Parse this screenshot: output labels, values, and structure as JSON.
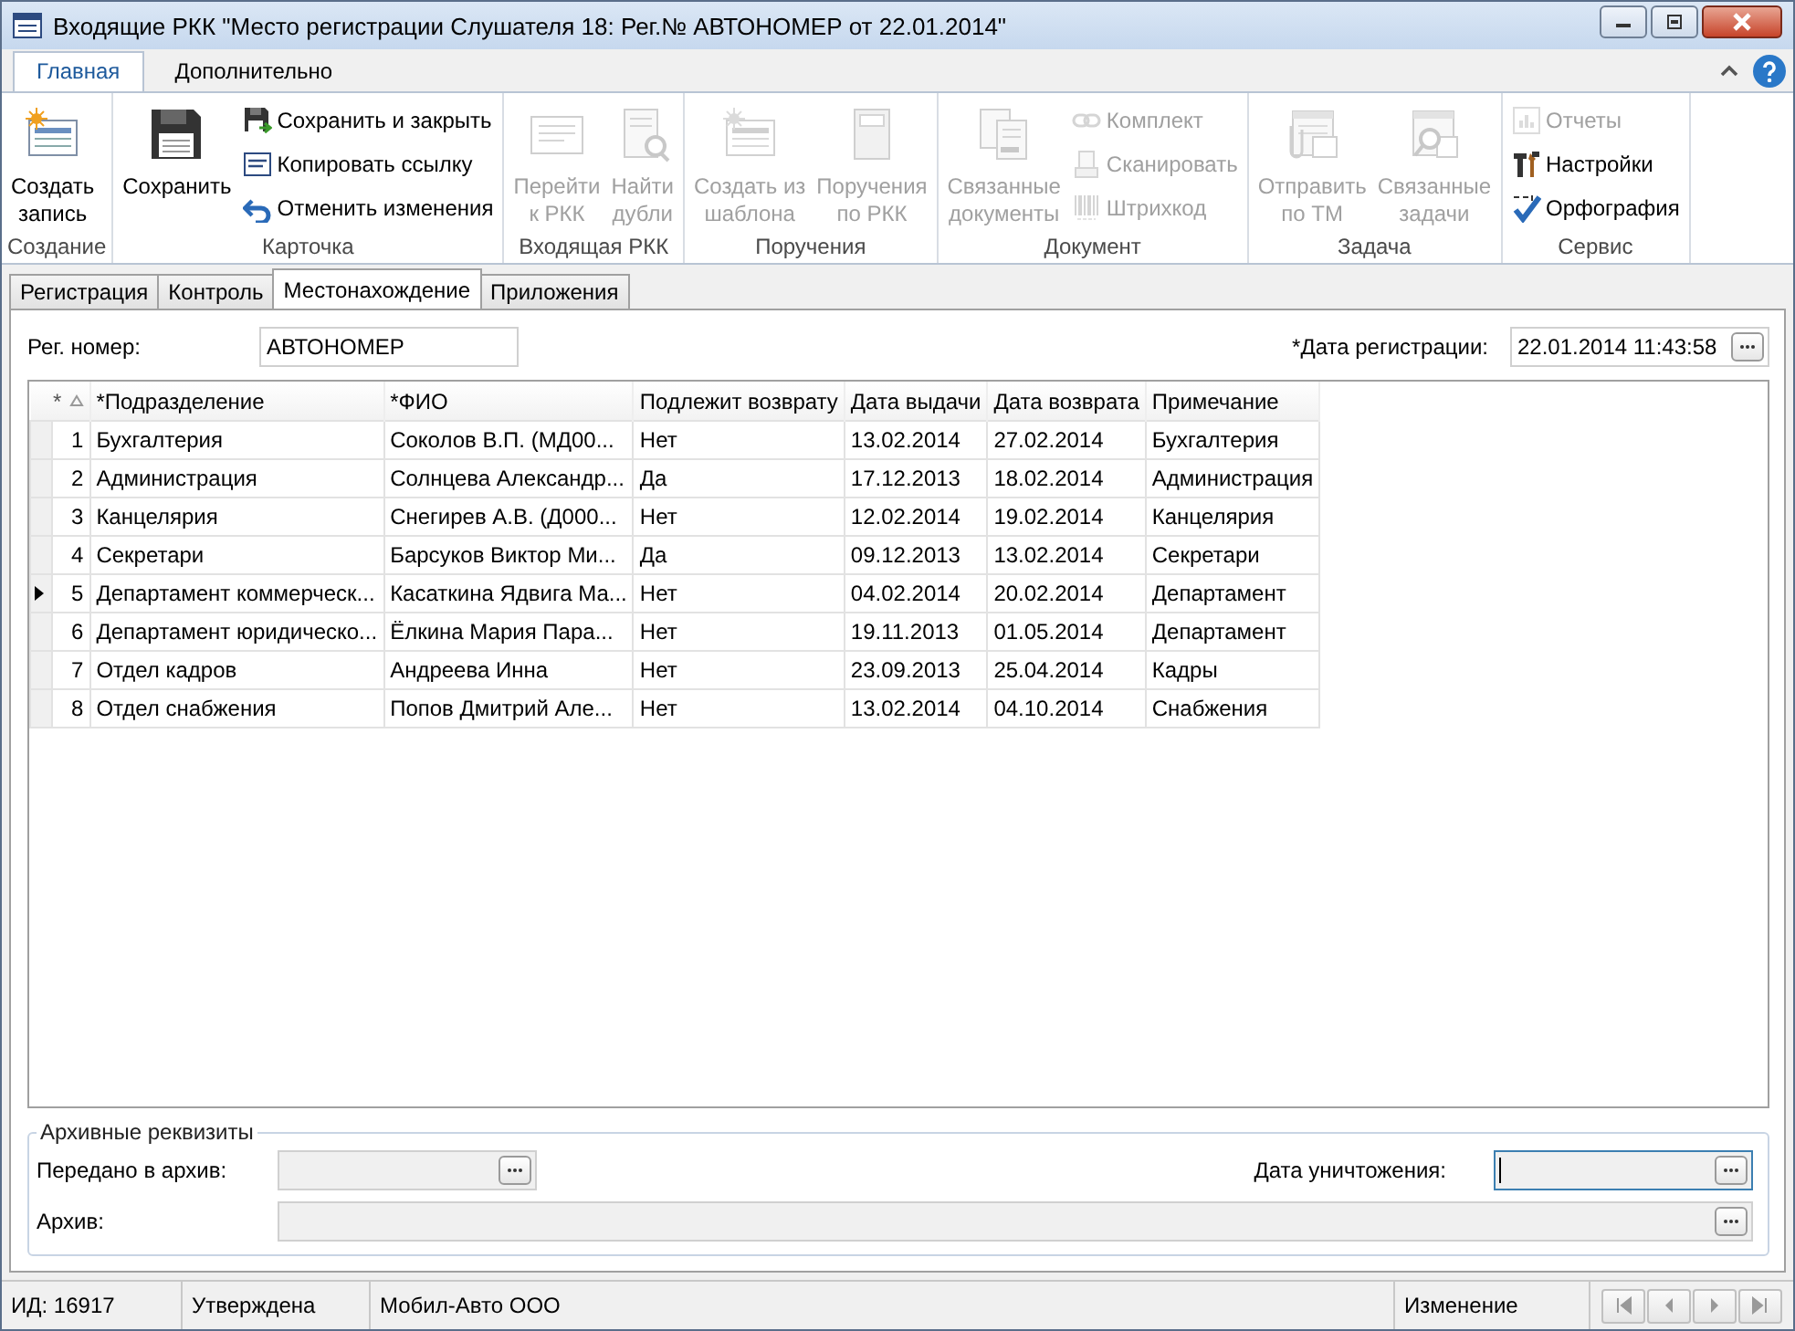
{
  "window": {
    "title": "Входящие РКК \"Место регистрации Слушателя 18: Рег.№ АВТОНОМЕР от 22.01.2014\""
  },
  "ribbon_tabs": [
    {
      "label": "Главная",
      "selected": true
    },
    {
      "label": "Дополнительно",
      "selected": false
    }
  ],
  "ribbon_groups": [
    {
      "label": "Создание",
      "buttons": [
        {
          "kind": "large",
          "label": "Создать\nзапись",
          "disabled": false
        }
      ]
    },
    {
      "label": "Карточка",
      "buttons": [
        {
          "kind": "large",
          "label": "Сохранить",
          "disabled": false
        },
        {
          "kind": "small",
          "label": "Сохранить и закрыть",
          "disabled": false
        },
        {
          "kind": "small",
          "label": "Копировать ссылку",
          "disabled": false
        },
        {
          "kind": "small",
          "label": "Отменить изменения",
          "disabled": false
        }
      ]
    },
    {
      "label": "Входящая РКК",
      "buttons": [
        {
          "kind": "large",
          "label": "Перейти\nк РКК",
          "disabled": true
        },
        {
          "kind": "large",
          "label": "Найти\nдубли",
          "disabled": true
        }
      ]
    },
    {
      "label": "Поручения",
      "buttons": [
        {
          "kind": "large",
          "label": "Создать из\nшаблона",
          "disabled": true
        },
        {
          "kind": "large",
          "label": "Поручения\nпо РКК",
          "disabled": true
        }
      ]
    },
    {
      "label": "Документ",
      "buttons": [
        {
          "kind": "large",
          "label": "Связанные\nдокументы",
          "disabled": true
        },
        {
          "kind": "small",
          "label": "Комплект",
          "disabled": true
        },
        {
          "kind": "small",
          "label": "Сканировать",
          "disabled": true
        },
        {
          "kind": "small",
          "label": "Штрихкод",
          "disabled": true
        }
      ]
    },
    {
      "label": "Задача",
      "buttons": [
        {
          "kind": "large",
          "label": "Отправить\nпо ТМ",
          "disabled": true
        },
        {
          "kind": "large",
          "label": "Связанные\nзадачи",
          "disabled": true
        }
      ]
    },
    {
      "label": "Сервис",
      "buttons": [
        {
          "kind": "small",
          "label": "Отчеты",
          "disabled": true
        },
        {
          "kind": "small",
          "label": "Настройки",
          "disabled": false
        },
        {
          "kind": "small",
          "label": "Орфография",
          "disabled": false
        }
      ]
    }
  ],
  "doc_tabs": [
    {
      "label": "Регистрация",
      "selected": false
    },
    {
      "label": "Контроль",
      "selected": false
    },
    {
      "label": "Местонахождение",
      "selected": true
    },
    {
      "label": "Приложения",
      "selected": false
    }
  ],
  "reg_number": {
    "label": "Рег. номер:",
    "value": "АВТОНОМЕР"
  },
  "reg_date": {
    "label": "*Дата регистрации:",
    "value": "22.01.2014 11:43:58"
  },
  "table": {
    "marker": "*",
    "columns": [
      "*Подразделение",
      "*ФИО",
      "Подлежит возврату",
      "Дата выдачи",
      "Дата возврата",
      "Примечание"
    ],
    "rows": [
      {
        "num": "1",
        "current": false,
        "cells": [
          "Бухгалтерия",
          "Соколов В.П. (МД00...",
          "Нет",
          "13.02.2014",
          "27.02.2014",
          "Бухгалтерия"
        ]
      },
      {
        "num": "2",
        "current": false,
        "cells": [
          "Администрация",
          "Солнцева Александр...",
          "Да",
          "17.12.2013",
          "18.02.2014",
          "Администрация"
        ]
      },
      {
        "num": "3",
        "current": false,
        "cells": [
          "Канцелярия",
          "Снегирев А.В.  (Д000...",
          "Нет",
          "12.02.2014",
          "19.02.2014",
          "Канцелярия"
        ]
      },
      {
        "num": "4",
        "current": false,
        "cells": [
          "Секретари",
          "Барсуков Виктор Ми...",
          "Да",
          "09.12.2013",
          "13.02.2014",
          "Секретари"
        ]
      },
      {
        "num": "5",
        "current": true,
        "cells": [
          "Департамент коммерческ...",
          "Касаткина Ядвига Ма...",
          "Нет",
          "04.02.2014",
          "20.02.2014",
          "Департамент"
        ]
      },
      {
        "num": "6",
        "current": false,
        "cells": [
          "Департамент юридическо...",
          "Ёлкина Мария Пара...",
          "Нет",
          "19.11.2013",
          "01.05.2014",
          "Департамент"
        ]
      },
      {
        "num": "7",
        "current": false,
        "cells": [
          "Отдел кадров",
          "Андреева Инна",
          "Нет",
          "23.09.2013",
          "25.04.2014",
          "Кадры"
        ]
      },
      {
        "num": "8",
        "current": false,
        "cells": [
          "Отдел снабжения",
          "Попов Дмитрий Але...",
          "Нет",
          "13.02.2014",
          "04.10.2014",
          "Снабжения"
        ]
      }
    ]
  },
  "archive": {
    "title": "Архивные реквизиты",
    "transferred": {
      "label": "Передано в архив:",
      "focused": false
    },
    "destroy_date": {
      "label": "Дата уничтожения:",
      "focused": true
    },
    "archive": {
      "label": "Архив:",
      "focused": false
    }
  },
  "status_bar": [
    "ИД: 16917",
    "Утверждена",
    "Мобил-Авто ООО",
    "Изменение"
  ]
}
